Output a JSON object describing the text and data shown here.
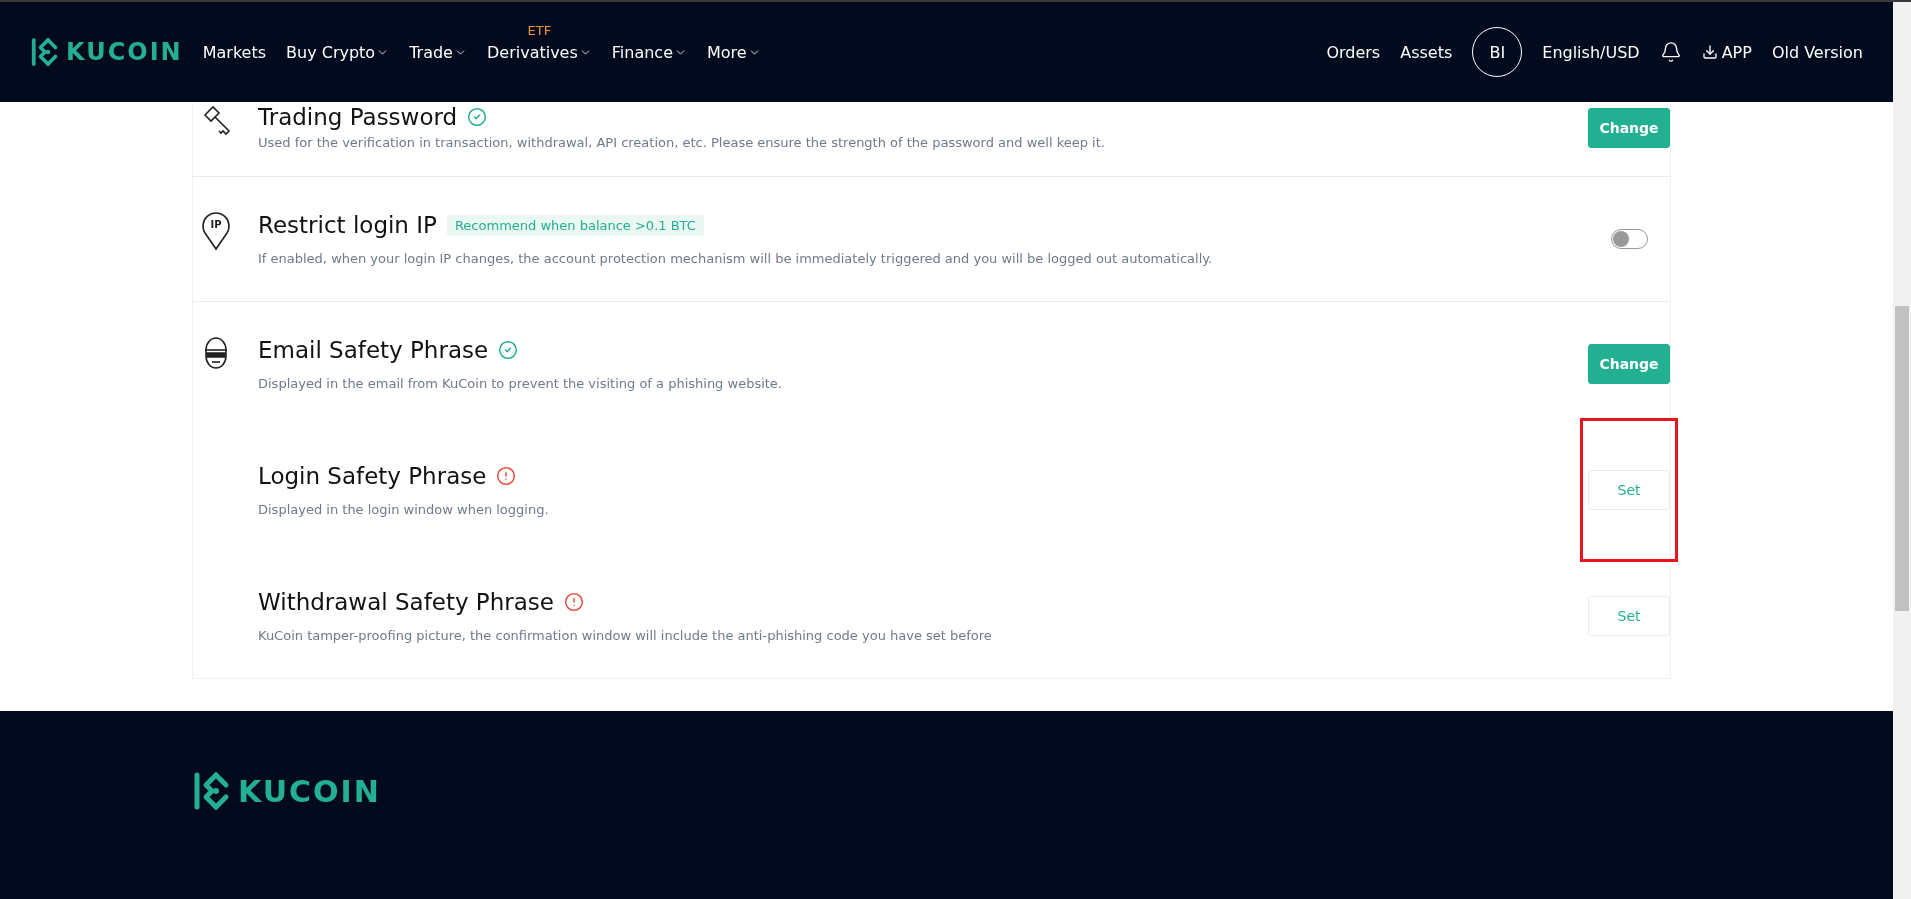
{
  "header": {
    "logo": "KUCOIN",
    "menu": [
      {
        "label": "Markets",
        "dropdown": false
      },
      {
        "label": "Buy Crypto",
        "dropdown": true
      },
      {
        "label": "Trade",
        "dropdown": true
      },
      {
        "label": "Derivatives",
        "dropdown": true,
        "badge": "ETF"
      },
      {
        "label": "Finance",
        "dropdown": true
      },
      {
        "label": "More",
        "dropdown": true
      }
    ],
    "right": [
      {
        "kind": "link",
        "label": "Orders"
      },
      {
        "kind": "link",
        "label": "Assets"
      },
      {
        "kind": "avatar",
        "label": "BI"
      },
      {
        "kind": "link",
        "label": "English/USD"
      },
      {
        "kind": "bell"
      },
      {
        "kind": "download",
        "label": "APP"
      },
      {
        "kind": "link",
        "label": "Old Version"
      }
    ]
  },
  "security_groups": [
    {
      "items": [
        {
          "title": "Trading Password",
          "verified": true,
          "description": "Used for the verification in transaction, withdrawal, API creation, etc. Please ensure the strength of the password and well keep it.",
          "control": {
            "kind": "filled_button",
            "label": "Change"
          },
          "highlighted": false
        }
      ]
    },
    {
      "icon_text": "IP",
      "items": [
        {
          "title": "Restrict login IP",
          "tag": "Recommend when balance >0.1 BTC",
          "description": "If enabled, when your login IP changes, the account protection mechanism will be immediately triggered and you will be logged out automatically.",
          "control": {
            "kind": "switch",
            "on": false
          },
          "highlighted": false
        }
      ]
    },
    {
      "items": [
        {
          "title": "Email Safety Phrase",
          "verified": true,
          "description": "Displayed in the email from KuCoin to prevent the visiting of a phishing website.",
          "control": {
            "kind": "filled_button",
            "label": "Change"
          },
          "highlighted": false
        },
        {
          "title": "Login Safety Phrase",
          "verified": false,
          "description": "Displayed in the login window when logging.",
          "control": {
            "kind": "outline_button",
            "label": "Set"
          },
          "highlighted": true
        },
        {
          "title": "Withdrawal Safety Phrase",
          "verified": false,
          "description": "KuCoin tamper-proofing picture, the confirmation window will include the anti-phishing code you have set before",
          "control": {
            "kind": "outline_button",
            "label": "Set"
          },
          "highlighted": false
        }
      ]
    }
  ],
  "footer": {
    "logo": "KUCOIN"
  }
}
